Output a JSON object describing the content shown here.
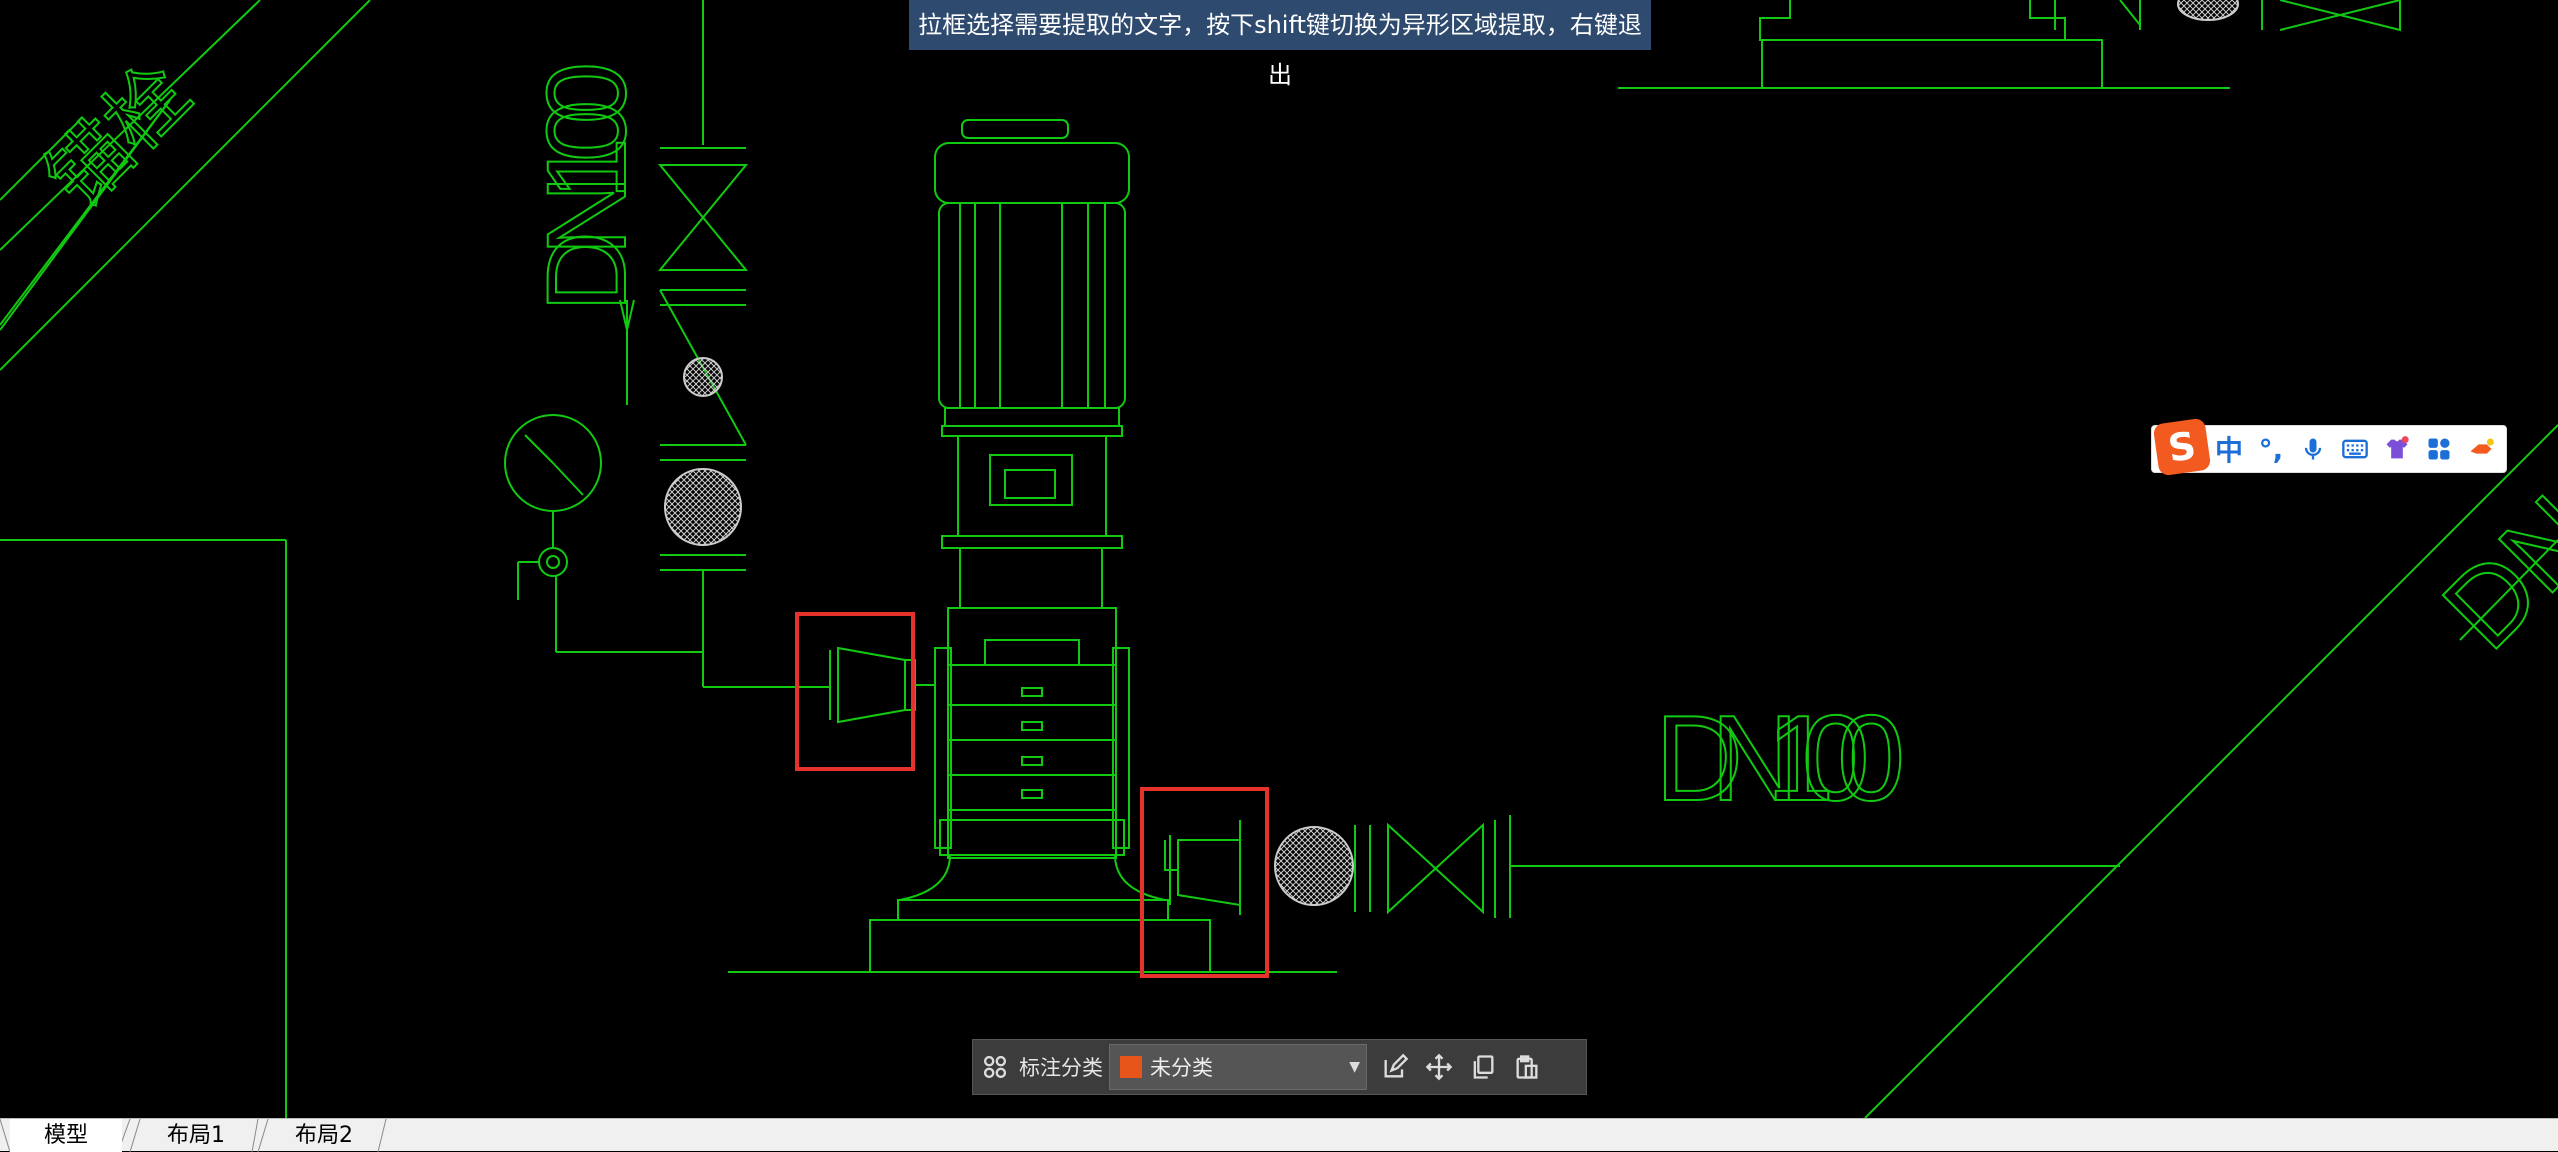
{
  "hint": {
    "text": "拉框选择需要提取的文字，按下shift键切换为异形区域提取，右键退出"
  },
  "drawing": {
    "labels": {
      "dn_vertical": "DN100",
      "dn_horizontal": "DN100",
      "dn_corner": "DN"
    },
    "colors": {
      "line": "#12c912",
      "highlight": "#e5322b",
      "background": "#000000"
    }
  },
  "ime": {
    "logo": "S",
    "mode_label": "中",
    "punct_label": "°,",
    "icons": [
      "mic-icon",
      "keyboard-icon",
      "skin-icon",
      "apps-icon",
      "settings-icon"
    ]
  },
  "toolbar": {
    "label": "标注分类",
    "select_value": "未分类",
    "swatch_color": "#e8551a",
    "icons": [
      "category-grid-icon",
      "edit-icon",
      "move-icon",
      "copy-icon",
      "paste-icon"
    ]
  },
  "tabs": [
    {
      "label": "模型",
      "active": true
    },
    {
      "label": "布局1",
      "active": false
    },
    {
      "label": "布局2",
      "active": false
    }
  ]
}
